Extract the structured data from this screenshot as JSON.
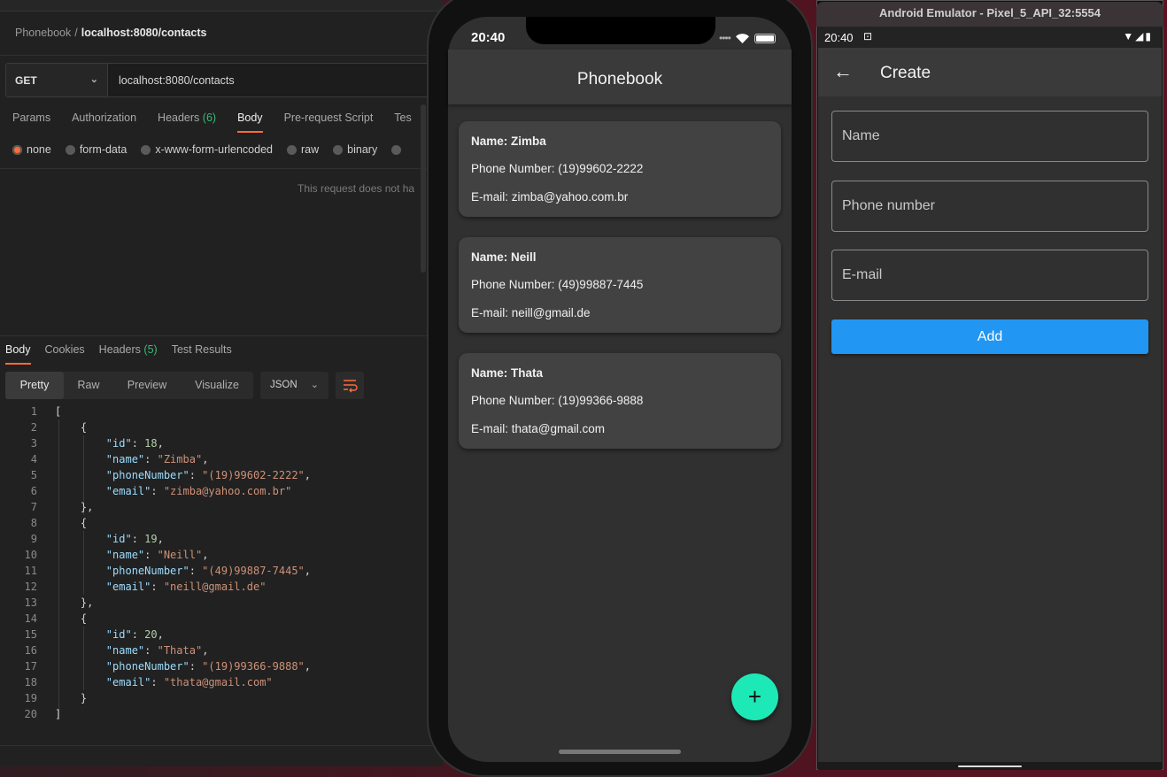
{
  "postman": {
    "breadcrumb": {
      "collection": "Phonebook",
      "separator": "/",
      "request": "localhost:8080/contacts"
    },
    "method": "GET",
    "url": "localhost:8080/contacts",
    "request_tabs": [
      {
        "label": "Params"
      },
      {
        "label": "Authorization"
      },
      {
        "label": "Headers",
        "count": "(6)"
      },
      {
        "label": "Body",
        "active": true
      },
      {
        "label": "Pre-request Script"
      },
      {
        "label": "Tes"
      }
    ],
    "body_types": [
      "none",
      "form-data",
      "x-www-form-urlencoded",
      "raw",
      "binary"
    ],
    "selected_body_type": "none",
    "no_body_message": "This request does not ha",
    "response_tabs": [
      {
        "label": "Body",
        "active": true
      },
      {
        "label": "Cookies"
      },
      {
        "label": "Headers",
        "count": "(5)"
      },
      {
        "label": "Test Results"
      }
    ],
    "view_modes": [
      "Pretty",
      "Raw",
      "Preview",
      "Visualize"
    ],
    "active_view_mode": "Pretty",
    "format": "JSON",
    "response_lines": [
      "[",
      "    {",
      "        \"id\": 18,",
      "        \"name\": \"Zimba\",",
      "        \"phoneNumber\": \"(19)99602-2222\",",
      "        \"email\": \"zimba@yahoo.com.br\"",
      "    },",
      "    {",
      "        \"id\": 19,",
      "        \"name\": \"Neill\",",
      "        \"phoneNumber\": \"(49)99887-7445\",",
      "        \"email\": \"neill@gmail.de\"",
      "    },",
      "    {",
      "        \"id\": 20,",
      "        \"name\": \"Thata\",",
      "        \"phoneNumber\": \"(19)99366-9888\",",
      "        \"email\": \"thata@gmail.com\"",
      "    }",
      "]"
    ],
    "colors": {
      "accent": "#ff6c37",
      "count_green": "#3bb879"
    }
  },
  "ios_app": {
    "time": "20:40",
    "title": "Phonebook",
    "contacts": [
      {
        "name": "Name: Zimba",
        "phone": "Phone Number: (19)99602-2222",
        "email": "E-mail: zimba@yahoo.com.br"
      },
      {
        "name": "Name: Neill",
        "phone": "Phone Number: (49)99887-7445",
        "email": "E-mail: neill@gmail.de"
      },
      {
        "name": "Name: Thata",
        "phone": "Phone Number: (19)99366-9888",
        "email": "E-mail: thata@gmail.com"
      }
    ],
    "fab_icon": "plus-icon",
    "fab_symbol": "+",
    "fab_color": "#1de9b6"
  },
  "android": {
    "window_title": "Android Emulator - Pixel_5_API_32:5554",
    "time": "20:40",
    "screen_title": "Create",
    "back_symbol": "←",
    "fields": [
      {
        "label": "Name"
      },
      {
        "label": "Phone number"
      },
      {
        "label": "E-mail"
      }
    ],
    "add_button": "Add",
    "button_color": "#2196f3"
  }
}
